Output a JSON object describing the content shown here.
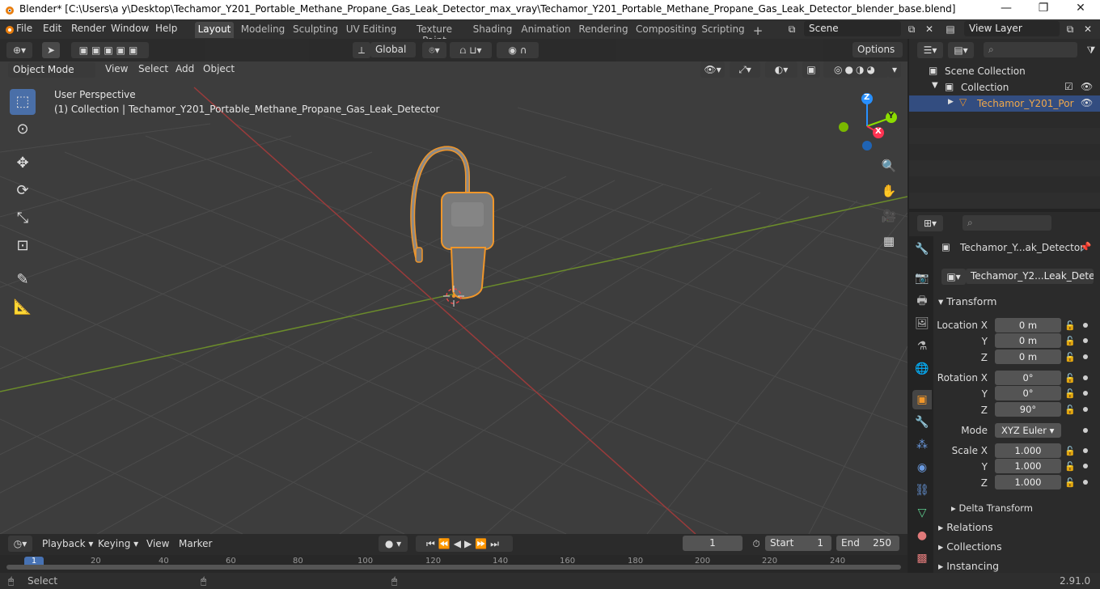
{
  "window": {
    "title": "Blender* [C:\\Users\\a y\\Desktop\\Techamor_Y201_Portable_Methane_Propane_Gas_Leak_Detector_max_vray\\Techamor_Y201_Portable_Methane_Propane_Gas_Leak_Detector_blender_base.blend]",
    "minimize": "—",
    "maximize": "❐",
    "close": "✕"
  },
  "menu": [
    "File",
    "Edit",
    "Render",
    "Window",
    "Help"
  ],
  "workspaces": [
    "Layout",
    "Modeling",
    "Sculpting",
    "UV Editing",
    "Texture Paint",
    "Shading",
    "Animation",
    "Rendering",
    "Compositing",
    "Scripting"
  ],
  "add_workspace": "+",
  "scene": {
    "label": "Scene",
    "view_layer": "View Layer"
  },
  "toolbar": {
    "orientation": "Global",
    "options": "Options"
  },
  "vp_header": {
    "mode": "Object Mode",
    "items": [
      "View",
      "Select",
      "Add",
      "Object"
    ]
  },
  "viewport": {
    "perspective": "User Perspective",
    "collection_info": "(1) Collection | Techamor_Y201_Portable_Methane_Propane_Gas_Leak_Detector",
    "gizmo": {
      "x": "X",
      "y": "Y",
      "z": "Z"
    }
  },
  "outliner": {
    "search_placeholder": "",
    "scene_collection": "Scene Collection",
    "collection": "Collection",
    "object": "Techamor_Y201_Por"
  },
  "properties": {
    "search_placeholder": "",
    "object_name": "Techamor_Y...ak_Detector",
    "data_name": "Techamor_Y2...Leak_Detector",
    "transform": "Transform",
    "location_x_label": "Location X",
    "y_label": "Y",
    "z_label": "Z",
    "rotation_x_label": "Rotation X",
    "mode_label": "Mode",
    "scale_x_label": "Scale X",
    "location": [
      "0 m",
      "0 m",
      "0 m"
    ],
    "rotation": [
      "0°",
      "0°",
      "90°"
    ],
    "mode": "XYZ Euler",
    "scale": [
      "1.000",
      "1.000",
      "1.000"
    ],
    "delta_transform": "Delta Transform",
    "relations": "Relations",
    "collections": "Collections",
    "instancing": "Instancing"
  },
  "timeline": {
    "menus": [
      "Playback",
      "Keying",
      "View",
      "Marker"
    ],
    "current_frame": "1",
    "start_label": "Start",
    "start": "1",
    "end_label": "End",
    "end": "250",
    "ruler": [
      "1",
      "20",
      "40",
      "60",
      "80",
      "100",
      "120",
      "140",
      "160",
      "180",
      "200",
      "220",
      "240"
    ]
  },
  "status": {
    "select": "Select",
    "version": "2.91.0"
  },
  "colors": {
    "accent": "#4772b3",
    "selection_outline": "#f0962a",
    "x_axis": "#ff3352",
    "y_axis": "#8bdc00",
    "z_axis": "#2890ff"
  }
}
